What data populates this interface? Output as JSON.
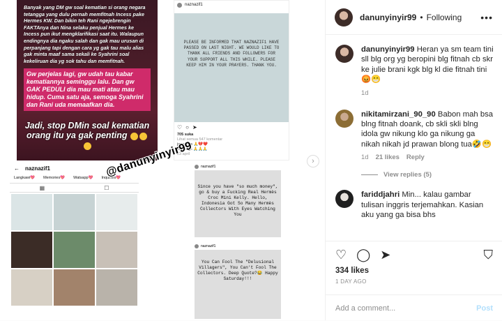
{
  "post_image": {
    "story": {
      "p1": "Banyak yang DM gw soal kematian si orang negara tetangga yang dulu pernah memfitnah Incess pake Hermes KW. Dan bikin teh Rani ngejebrengin FAKTAnya dan Nina selaku penjual Hermes ke Incess pun ikut mengklarifikasi saat itu. Walaupun endingnya dia ngaku salah dan gak mau urusan di perpanjang tapi dengan cara yg gak tau malu alias gak minta maaf sama sekali ke Syahrini soal kekeliruan dia yg sok tahu dan memfitnah.",
      "p2": "Gw perjelas lagi, gw udah tau kabar kematiannya seminggu lalu. Dan gw GAK PEDULI dia mau mati atau mau hidup. Cuma satu aja, semoga Syahrini dan Rani uda memaafkan dia.",
      "p3": "Jadi, stop DMin soal kematian orang itu ya gak penting"
    },
    "ig_card": {
      "username": "naznazif1",
      "notice": "PLEASE BE INFORMED THAT NAZNAZIF1 HAVE PASSED ON LAST NIGHT. WE WOULD LIKE TO THANK ALL FRIENDS AND FOLLOWERS FOR YOUR SUPPORT ALL THIS WHILE. PLEASE KEEP HIM IN YOUR PRAYERS. THANK YOU.",
      "likes": "705 suka",
      "comments_link": "Lihat semua 547 komentar",
      "comment1": "janefinds 🙏💔❤️",
      "comment2": "kanelk_k 🙏🙏🙏",
      "ago": "23 april"
    },
    "profile": {
      "username": "naznazif1",
      "highlights": [
        "Langkawi💖",
        "Memories💖",
        "Watsapp💖",
        "Inquiries💖"
      ]
    },
    "watermark": "@danunyinyir99",
    "card2": {
      "username": "naznazif1",
      "text": "Since you have \"so much money\", go & buy a Fucking Real Hermès Croc Mini Kelly. Hello, Indonesia Got So Many Hermès Collectors With Eyes Watching You"
    },
    "card3": {
      "username": "naznazif1",
      "text": "You Can Fool The \"Delusional Villagers\", You Can't Fool The Collectors. Deep Quote?😂 Happy Saturday!!!"
    }
  },
  "header": {
    "username": "danunyinyir99",
    "separator": "•",
    "follow_status": "Following",
    "more": "•••"
  },
  "comments": [
    {
      "username": "danunyinyir99",
      "text": "Heran ya sm team tini sll blg org yg beropini blg fitnah cb skr ke julie brani kgk blg kl die fitnah tini 😡😁",
      "time": "1d"
    },
    {
      "username": "nikitamirzani_90_90",
      "text": "Babon mah bsa blng fitnah doank, cb skli skli blng idola gw nikung klo ga nikung ga nikah nikah jd prawan blong tua🤣😁",
      "time": "1d",
      "likes": "21 likes",
      "reply": "Reply",
      "view_replies": "View replies (5)"
    },
    {
      "username": "fariddjahri",
      "text": "Min... kalau gambar tulisan inggris terjemahkan. Kasian aku yang ga bisa bhs"
    }
  ],
  "actions": {
    "likes": "334 likes",
    "date": "1 DAY AGO"
  },
  "add_comment": {
    "placeholder": "Add a comment...",
    "post": "Post"
  },
  "icons": [
    "heart-icon",
    "comment-icon",
    "share-icon",
    "bookmark-icon",
    "chevron-right-icon",
    "grid-icon",
    "back-arrow-icon"
  ]
}
